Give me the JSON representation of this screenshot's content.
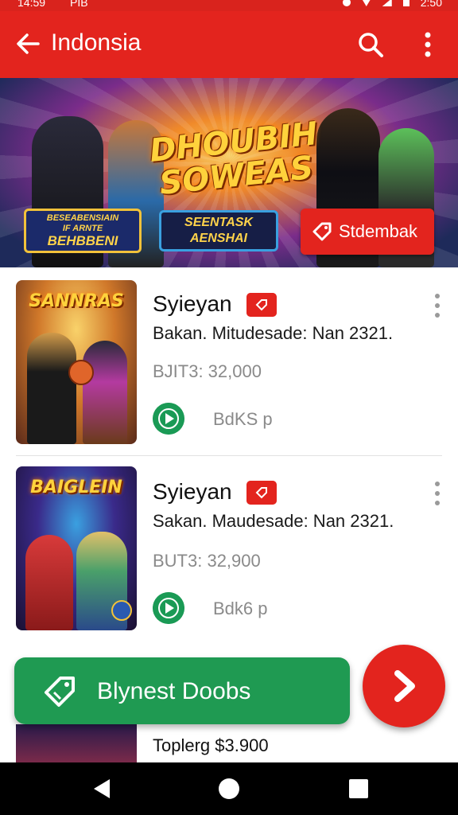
{
  "status_bar": {
    "time_left": "14:59",
    "carrier": "PIB",
    "time_right": "2:50"
  },
  "app_bar": {
    "title": "Indonsia",
    "back_icon": "arrow-back-icon",
    "search_icon": "search-icon",
    "more_icon": "more-vert-icon"
  },
  "banner": {
    "logo_line1": "DHOUBIH",
    "logo_line2": "SOWEAS",
    "card_a_line1": "BESEABENSIAIN",
    "card_a_line2": "IF ARNTE",
    "card_a_line3": "BEHBBENI",
    "card_b_line1": "SEENTASK",
    "card_b_line2": "AENSHAI",
    "cta_label": "Stdembak",
    "cta_icon": "tag-icon"
  },
  "items": [
    {
      "thumb_title": "SANNRAS",
      "name": "Syieyan",
      "description": "Bakan. Mitudesade: Nan 2321.",
      "price": "BJIT3:  32,000",
      "action_label": "BdKS p"
    },
    {
      "thumb_title": "BAIGLEIN",
      "name": "Syieyan",
      "description": "Sakan. Maudesade: Nan 2321.",
      "price": "BUT3:  32,900",
      "action_label": "Bdk6 p"
    }
  ],
  "fab_extended": {
    "label": "Blynest Doobs",
    "icon": "tag-icon"
  },
  "fab": {
    "icon": "chevron-right-icon"
  },
  "bottom": {
    "total": "Toplerg $3.900"
  },
  "nav": {
    "back": "nav-back-icon",
    "home": "nav-home-icon",
    "recents": "nav-recents-icon"
  },
  "colors": {
    "primary_red": "#e3241e",
    "green": "#1f9a52"
  }
}
